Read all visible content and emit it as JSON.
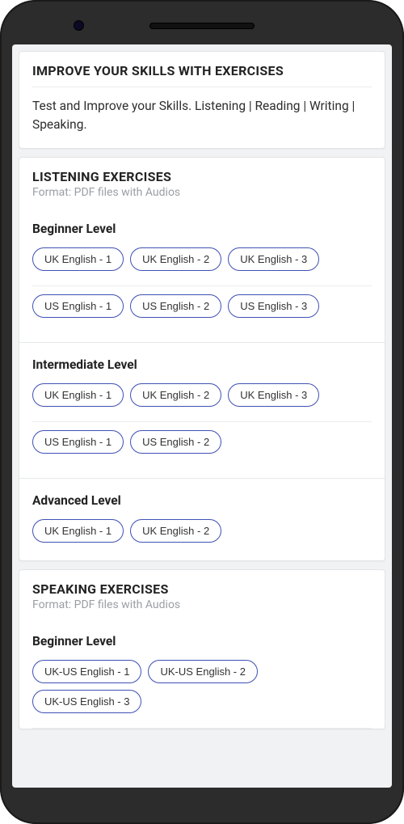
{
  "intro": {
    "title": "IMPROVE YOUR SKILLS WITH EXERCISES",
    "body": "Test and Improve your Skills. Listening | Reading | Writing | Speaking."
  },
  "listening": {
    "title": "LISTENING EXERCISES",
    "subtitle": "Format: PDF files with Audios",
    "levels": [
      {
        "name": "Beginner Level",
        "rows": [
          [
            "UK English - 1",
            "UK English - 2",
            "UK English - 3"
          ],
          [
            "US English - 1",
            "US English - 2",
            "US English - 3"
          ]
        ]
      },
      {
        "name": "Intermediate Level",
        "rows": [
          [
            "UK English - 1",
            "UK English - 2",
            "UK English - 3"
          ],
          [
            "US English - 1",
            "US English - 2"
          ]
        ]
      },
      {
        "name": "Advanced Level",
        "rows": [
          [
            "UK English - 1",
            "UK English - 2"
          ]
        ]
      }
    ]
  },
  "speaking": {
    "title": "SPEAKING EXERCISES",
    "subtitle": "Format: PDF files with Audios",
    "levels": [
      {
        "name": "Beginner Level",
        "rows": [
          [
            "UK-US English - 1",
            "UK-US English - 2",
            "UK-US English - 3"
          ]
        ]
      }
    ]
  }
}
